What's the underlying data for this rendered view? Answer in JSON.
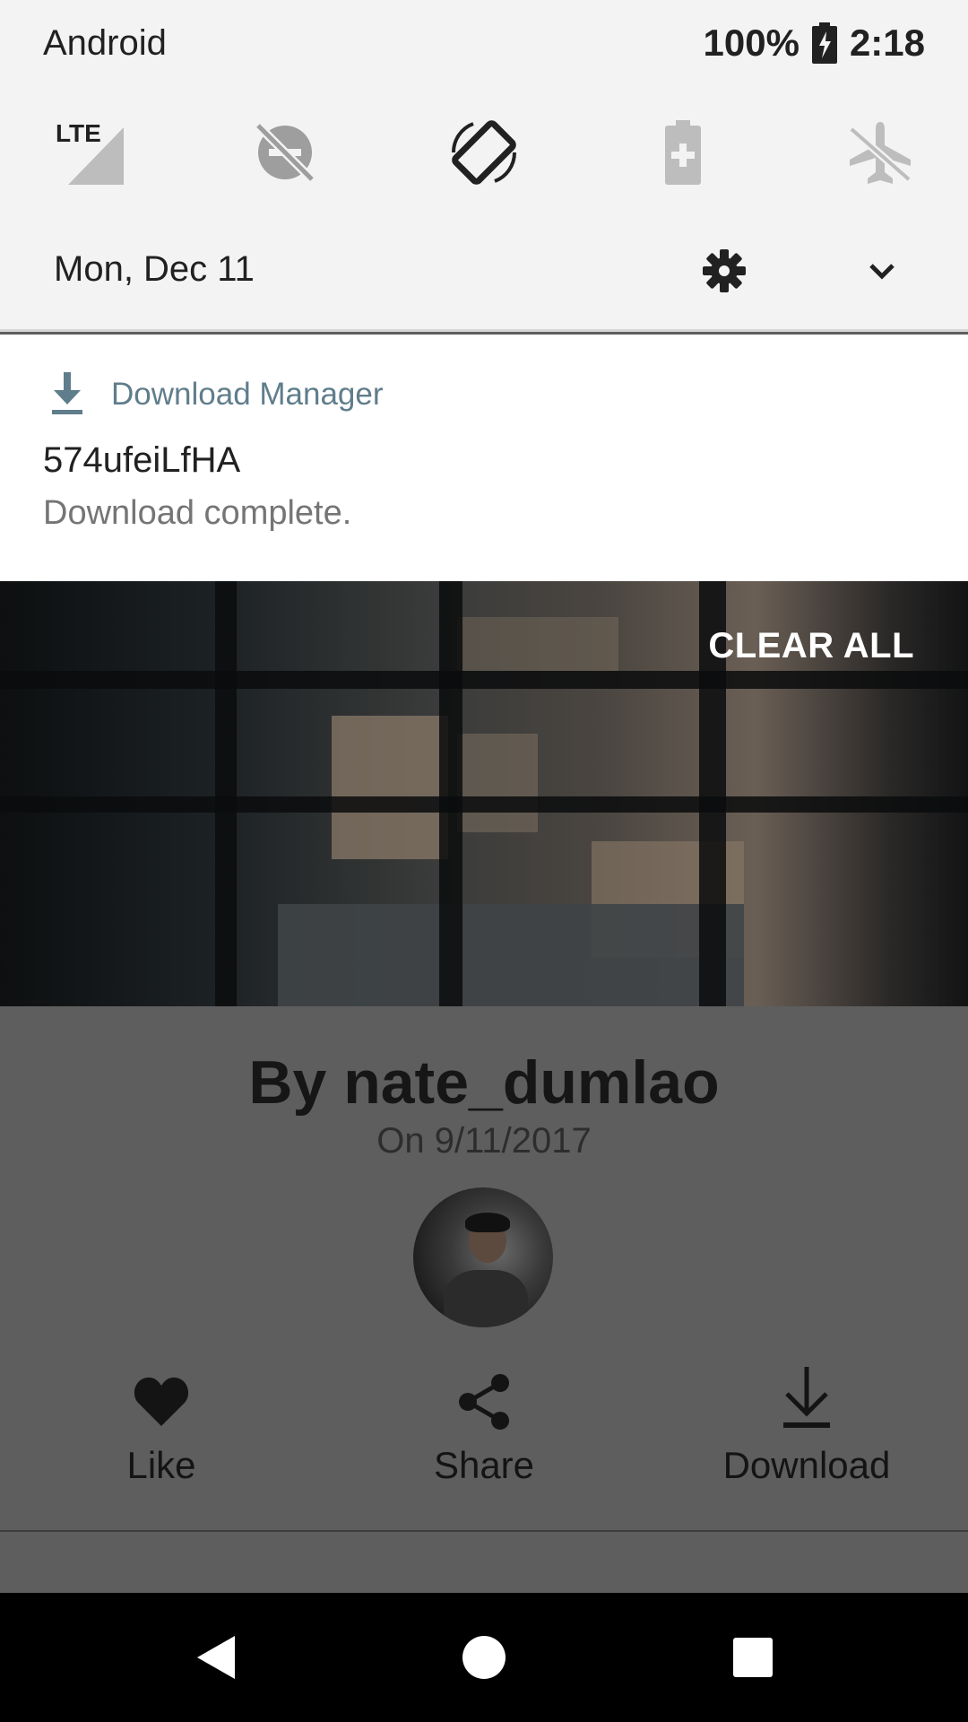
{
  "status_bar": {
    "carrier": "Android",
    "battery": "100%",
    "time": "2:18"
  },
  "quick_tiles": [
    {
      "name": "LTE"
    },
    {
      "name": "do-not-disturb-off"
    },
    {
      "name": "auto-rotate"
    },
    {
      "name": "battery-saver"
    },
    {
      "name": "airplane-mode"
    }
  ],
  "shade": {
    "date": "Mon, Dec 11"
  },
  "notification": {
    "app_name": "Download Manager",
    "title": "574ufeiLfHA",
    "text": "Download complete."
  },
  "clear_all_label": "CLEAR ALL",
  "photo_info": {
    "author": "By nate_dumlao",
    "date": "On 9/11/2017"
  },
  "actions": {
    "like_label": "Like",
    "share_label": "Share",
    "download_label": "Download"
  }
}
